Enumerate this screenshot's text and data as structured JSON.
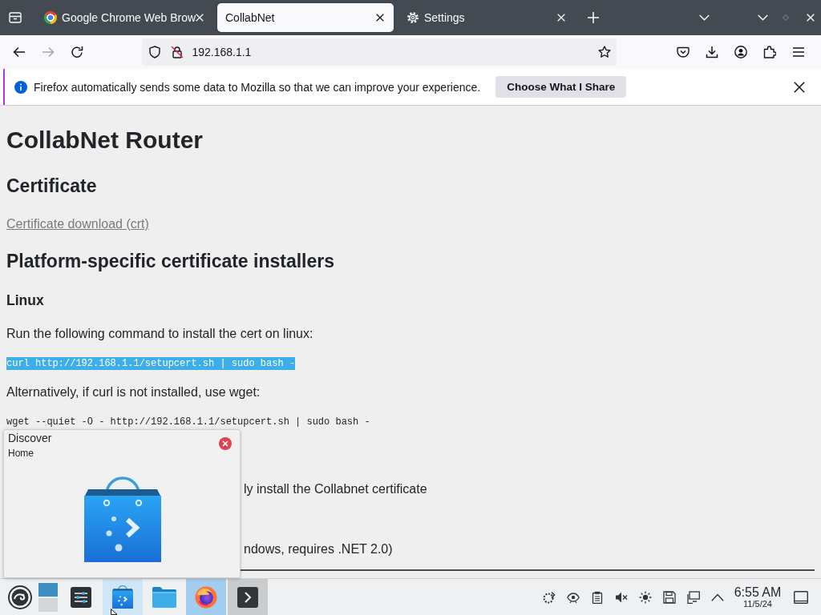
{
  "browser": {
    "tabs": [
      {
        "kind": "site",
        "label": "Google Chrome Web Brow",
        "selected": false
      },
      {
        "kind": "page",
        "label": "CollabNet",
        "selected": true
      },
      {
        "kind": "settings",
        "label": "Settings",
        "selected": false
      }
    ],
    "nav_buttons": [
      {
        "kind": "back",
        "disabled": false
      },
      {
        "kind": "forward",
        "disabled": true
      },
      {
        "kind": "reload",
        "disabled": false
      }
    ],
    "address": {
      "value": "192.168.1.1"
    },
    "notification": {
      "text": "Firefox automatically sends some data to Mozilla so that we can improve your experience.",
      "button": "Choose What I Share"
    }
  },
  "page": {
    "blocks": [
      {
        "kind": "h1",
        "text": "CollabNet Router"
      },
      {
        "kind": "h2",
        "text": "Certificate"
      },
      {
        "kind": "link",
        "text": "Certificate download (crt)"
      },
      {
        "kind": "h2",
        "text": "Platform-specific certificate installers"
      },
      {
        "kind": "h3",
        "text": "Linux"
      },
      {
        "kind": "p",
        "text": "Run the following command to install the cert on linux:"
      },
      {
        "kind": "code",
        "text": "curl http://192.168.1.1/setupcert.sh | sudo bash -",
        "selected": true
      },
      {
        "kind": "p",
        "text": "Alternatively, if curl is not installed, use wget:"
      },
      {
        "kind": "code",
        "text": "wget --quiet -O - http://192.168.1.1/setupcert.sh | sudo bash -",
        "selected": false
      },
      {
        "kind": "covered",
        "text": "ly install the Collabnet certificate"
      },
      {
        "kind": "covered",
        "text": "ndows, requires .NET 2.0)"
      }
    ]
  },
  "tooltip": {
    "title": "Discover",
    "subtitle": "Home"
  },
  "taskbar": {
    "tasks": [
      {
        "kind": "settings",
        "active": false,
        "hovered": false,
        "minimized": false
      },
      {
        "kind": "store",
        "active": false,
        "hovered": true,
        "minimized": false
      },
      {
        "kind": "files",
        "active": false,
        "hovered": false,
        "minimized": false
      },
      {
        "kind": "browser",
        "active": true,
        "hovered": false,
        "minimized": false
      },
      {
        "kind": "terminal",
        "active": false,
        "hovered": false,
        "minimized": true
      }
    ],
    "clock": {
      "time": "6:55 AM",
      "date": "11/5/24"
    }
  }
}
